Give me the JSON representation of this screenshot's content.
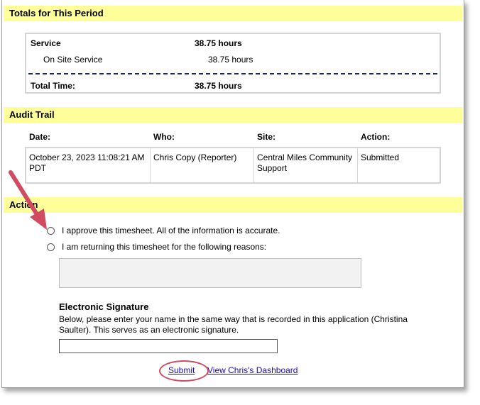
{
  "totals": {
    "header": "Totals for This Period",
    "service_label": "Service",
    "service_value": "38.75 hours",
    "onsite_label": "On Site Service",
    "onsite_value": "38.75 hours",
    "total_label": "Total Time:",
    "total_value": "38.75 hours"
  },
  "audit": {
    "header": "Audit Trail",
    "columns": [
      "Date:",
      "Who:",
      "Site:",
      "Action:"
    ],
    "row": {
      "date": "October 23, 2023 11:08:21 AM PDT",
      "who": "Chris Copy (Reporter)",
      "site": "Central Miles Community Support",
      "action": "Submitted"
    }
  },
  "actions": {
    "header": "Action",
    "approve_label": "I approve this timesheet. All of the information is accurate.",
    "return_label": "I am returning this timesheet for the following reasons:",
    "reasons_value": "",
    "signature_title": "Electronic Signature",
    "signature_help": "Below, please enter your name in the same way that is recorded in this application (Christina Saulter). This serves as an electronic signature.",
    "signature_value": "",
    "submit_label": "Submit",
    "dashboard_label": "View Chris's Dashboard"
  },
  "colors": {
    "section_bg": "#ffff99",
    "annotation": "#d14a5f",
    "link": "#1a0dab"
  }
}
